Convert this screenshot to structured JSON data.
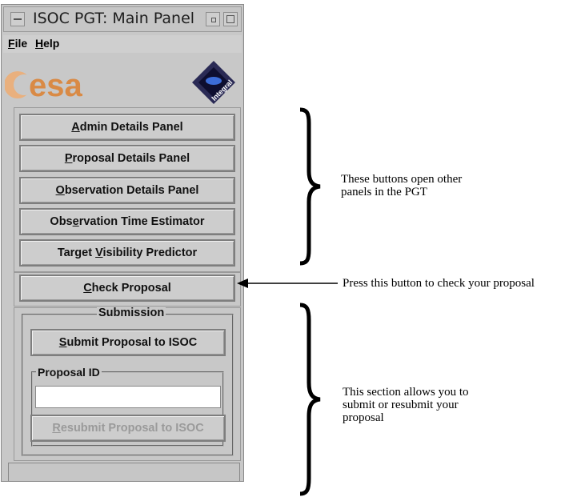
{
  "window": {
    "title": "ISOC PGT: Main Panel"
  },
  "menu": [
    {
      "label": "File"
    },
    {
      "label": "Help"
    }
  ],
  "logo": {
    "text": "esa",
    "badge_text": "Integral"
  },
  "buttons": [
    {
      "label": "Admin Details Panel",
      "mnemonic": "A"
    },
    {
      "label": "Proposal Details Panel",
      "mnemonic": "P"
    },
    {
      "label": "Observation Details Panel",
      "mnemonic": "O"
    },
    {
      "label": "Observation Time Estimator",
      "mnemonic": "e"
    },
    {
      "label": "Target Visibility Predictor",
      "mnemonic": "V"
    },
    {
      "label": "Check Proposal",
      "mnemonic": "C"
    }
  ],
  "submission": {
    "legend": "Submission",
    "submit_label": "Submit Proposal to ISOC",
    "proposal_id_legend": "Proposal ID",
    "proposal_id_value": "",
    "resubmit_label": "Resubmit Proposal to ISOC"
  },
  "annotations": {
    "panels_note_line1": "These buttons open other",
    "panels_note_line2": "panels in the PGT",
    "check_note": "Press this button to check your proposal",
    "submit_note_line1": "This section allows you to",
    "submit_note_line2": "submit or resubmit your",
    "submit_note_line3": "proposal"
  }
}
